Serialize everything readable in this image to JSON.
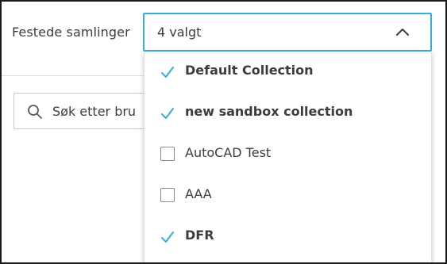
{
  "filter": {
    "label": "Festede samlinger",
    "selected_summary": "4 valgt",
    "expanded": true,
    "options": [
      {
        "label": "Default Collection",
        "checked": true
      },
      {
        "label": "new sandbox collection",
        "checked": true
      },
      {
        "label": "AutoCAD Test",
        "checked": false
      },
      {
        "label": "AAA",
        "checked": false
      },
      {
        "label": "DFR",
        "checked": true
      }
    ]
  },
  "search": {
    "placeholder": "Søk etter bru"
  },
  "colors": {
    "accent": "#38abdf",
    "text": "#3c3c3c",
    "checkbox_border": "#8a8a8a"
  },
  "icons": {
    "search": "search-icon",
    "chevron": "chevron-up-icon",
    "check": "check-icon",
    "checkbox": "checkbox-unchecked-icon"
  }
}
